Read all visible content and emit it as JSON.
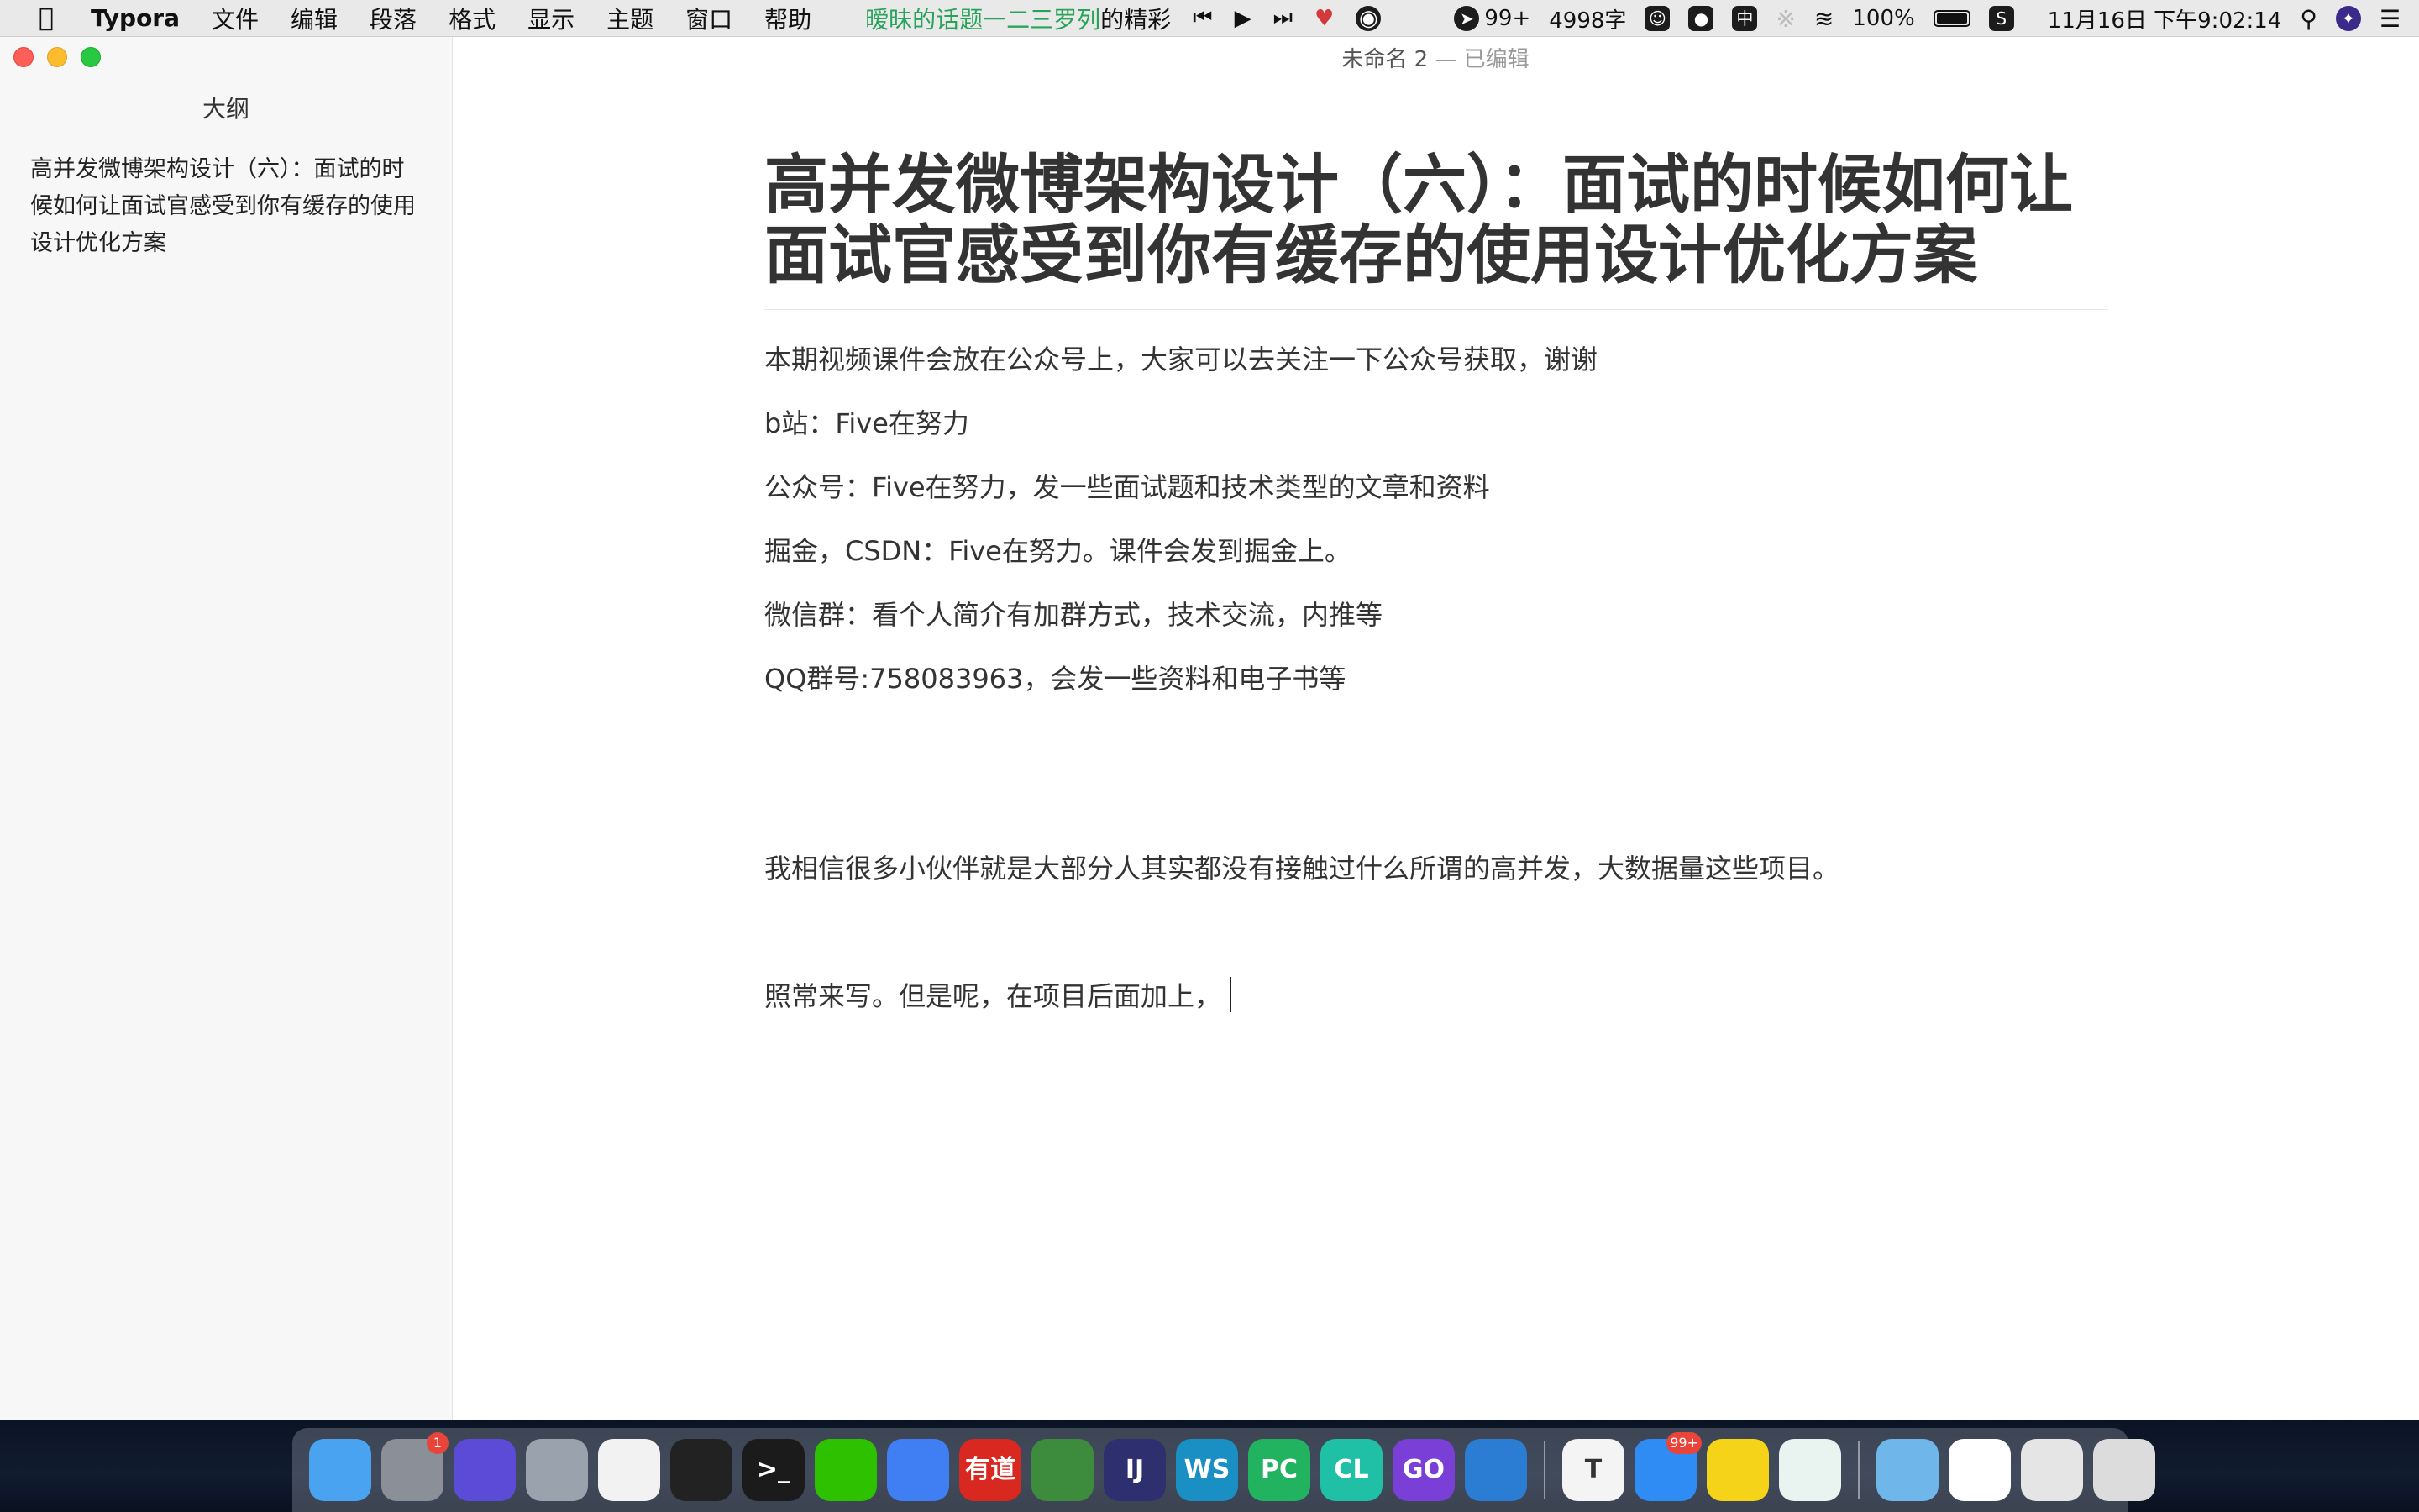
{
  "menubar": {
    "app_name": "Typora",
    "menus": [
      "文件",
      "编辑",
      "段落",
      "格式",
      "显示",
      "主题",
      "窗口",
      "帮助"
    ],
    "song_title": "暧昧的话题一二三罗列",
    "song_suffix": "的精彩",
    "notification_count": "99+",
    "word_count": "4998字",
    "input_method": "中",
    "battery": "100%",
    "datetime": "11月16日 下午9:02:14"
  },
  "window": {
    "title": "未命名 2",
    "edited_status": "— 已编辑"
  },
  "sidebar": {
    "heading": "大纲",
    "outline_items": [
      "高并发微博架构设计（六）：面试的时候如何让面试官感受到你有缓存的使用设计优化方案"
    ]
  },
  "document": {
    "heading": "高并发微博架构设计（六）：面试的时候如何让面试官感受到你有缓存的使用设计优化方案",
    "paragraphs": [
      "本期视频课件会放在公众号上，大家可以去关注一下公众号获取，谢谢",
      "b站：Five在努力",
      "公众号：Five在努力，发一些面试题和技术类型的文章和资料",
      "掘金，CSDN：Five在努力。课件会发到掘金上。",
      "微信群：看个人简介有加群方式，技术交流，内推等",
      "QQ群号:758083963，会发一些资料和电子书等",
      "我相信很多小伙伴就是大部分人其实都没有接触过什么所谓的高并发，大数据量这些项目。",
      "照常来写。但是呢，在项目后面加上，"
    ]
  },
  "dock": {
    "items": [
      {
        "name": "finder-icon",
        "label": "",
        "color": "#4aa3f0"
      },
      {
        "name": "system-preferences-icon",
        "label": "",
        "color": "#8a8f98",
        "badge": "1"
      },
      {
        "name": "siri-icon",
        "label": "",
        "color": "#5b4bd6"
      },
      {
        "name": "launchpad-icon",
        "label": "",
        "color": "#9aa3ad"
      },
      {
        "name": "chrome-icon",
        "label": "",
        "color": "#f2f2f2"
      },
      {
        "name": "qq-icon",
        "label": "",
        "color": "#222222"
      },
      {
        "name": "terminal-icon",
        "label": ">_",
        "color": "#1b1b1b"
      },
      {
        "name": "wechat-icon",
        "label": "",
        "color": "#2dc100"
      },
      {
        "name": "lark-icon",
        "label": "",
        "color": "#3f7ff3"
      },
      {
        "name": "youdao-icon",
        "label": "有道",
        "color": "#d8281f"
      },
      {
        "name": "anaconda-icon",
        "label": "",
        "color": "#3d8b3d"
      },
      {
        "name": "intellij-icon",
        "label": "IJ",
        "color": "#2d2f6e"
      },
      {
        "name": "webstorm-icon",
        "label": "WS",
        "color": "#1a8fc4"
      },
      {
        "name": "pycharm-icon",
        "label": "PC",
        "color": "#21b35f"
      },
      {
        "name": "clion-icon",
        "label": "CL",
        "color": "#1fc0a5"
      },
      {
        "name": "goland-icon",
        "label": "GO",
        "color": "#7a3fd6"
      },
      {
        "name": "vscode-icon",
        "label": "",
        "color": "#2a7dd2"
      },
      {
        "name": "typora-icon",
        "label": "T",
        "color": "#f4f4f4"
      },
      {
        "name": "dingtalk-icon",
        "label": "",
        "color": "#2f8cf5",
        "badge": "99+"
      },
      {
        "name": "qq-music-icon",
        "label": "",
        "color": "#f5d319"
      },
      {
        "name": "evernote-icon",
        "label": "",
        "color": "#e9f3ef"
      },
      {
        "name": "downloads-folder-icon",
        "label": "",
        "color": "#6fb7ea"
      },
      {
        "name": "document-preview-icon",
        "label": "",
        "color": "#ffffff"
      },
      {
        "name": "app-window-icon",
        "label": "",
        "color": "#e5e5e5"
      },
      {
        "name": "trash-icon",
        "label": "",
        "color": "#dcdcdc"
      }
    ]
  }
}
